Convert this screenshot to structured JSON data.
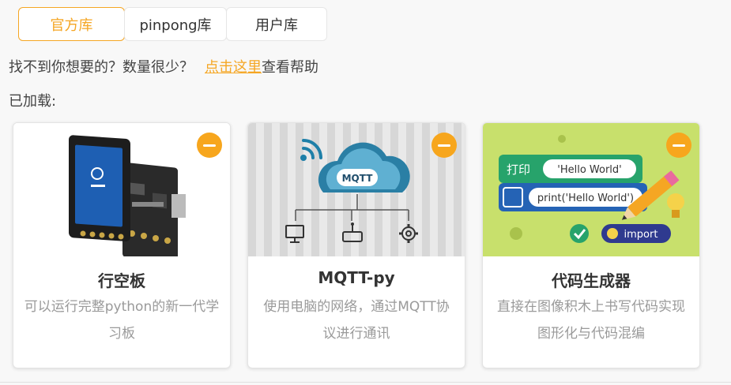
{
  "tabs": [
    {
      "label": "官方库",
      "active": true
    },
    {
      "label": "pinpong库",
      "active": false
    },
    {
      "label": "用户库",
      "active": false
    }
  ],
  "help": {
    "text": "找不到你想要的？数量很少？",
    "link": "点击这里",
    "suffix": "查看帮助"
  },
  "loaded_label": "已加载:",
  "cards": [
    {
      "name": "行空板",
      "desc": "可以运行完整python的新一代学习板"
    },
    {
      "name": "MQTT-py",
      "desc": "使用电脑的网络，通过MQTT协议进行通讯",
      "image_text": "MQTT"
    },
    {
      "name": "代码生成器",
      "desc": "直接在图像积木上书写代码实现图形化与代码混编",
      "image_blocks": {
        "print_cn": "打印",
        "hello": "'Hello World'",
        "print_code": "print('Hello World')",
        "import": "import"
      }
    }
  ],
  "colors": {
    "accent": "#f5a623",
    "remove": "#f7a61d"
  }
}
